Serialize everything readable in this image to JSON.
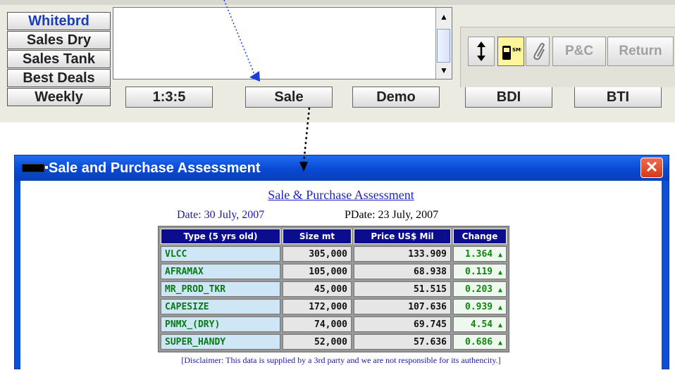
{
  "side_buttons": [
    "Whitebrd",
    "Sales Dry",
    "Sales Tank",
    "Best Deals",
    "Weekly"
  ],
  "bottom_buttons": [
    "1:3:5",
    "Sale",
    "Demo",
    "BDI",
    "BTI"
  ],
  "tool_buttons": {
    "updown_icon": "up-down-arrow-icon",
    "sms_icon": "sms-phone-icon",
    "attach_icon": "paperclip-icon",
    "pc_label": "P&C",
    "return_label": "Return"
  },
  "dialog": {
    "title": "Sale and Purchase Assessment",
    "heading": "Sale & Purchase Assessment",
    "date": "Date: 30 July, 2007",
    "pdate": "PDate: 23 July, 2007",
    "table": {
      "headers": [
        "Type (5 yrs old)",
        "Size mt",
        "Price US$ Mil",
        "Change"
      ],
      "rows": [
        {
          "type": "VLCC",
          "size": "305,000",
          "price": "133.909",
          "change": "1.364"
        },
        {
          "type": "AFRAMAX",
          "size": "105,000",
          "price": "68.938",
          "change": "0.119"
        },
        {
          "type": "MR_PROD_TKR",
          "size": "45,000",
          "price": "51.515",
          "change": "0.203"
        },
        {
          "type": "CAPESIZE",
          "size": "172,000",
          "price": "107.636",
          "change": "0.939"
        },
        {
          "type": "PNMX_(DRY)",
          "size": "74,000",
          "price": "69.745",
          "change": "4.54"
        },
        {
          "type": "SUPER_HANDY",
          "size": "52,000",
          "price": "57.636",
          "change": "0.686"
        }
      ]
    },
    "disclaimer": "[Disclaimer: This data is supplied by a 3rd party and we are not responsible for its authencity.]"
  },
  "colors": {
    "titlebar": "#0a4fd6",
    "header_bg": "#0c0c8f",
    "type_text": "#0a7a17",
    "change_text": "#0a8a0a",
    "link_blue": "#1f1fc8"
  }
}
